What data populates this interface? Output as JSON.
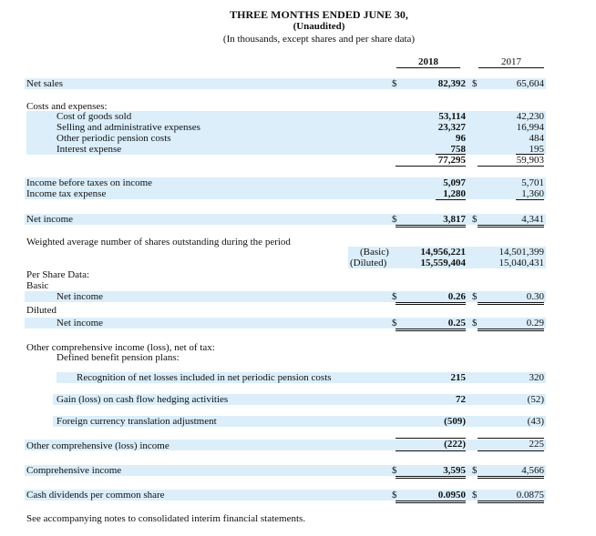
{
  "header": {
    "title": "THREE MONTHS ENDED JUNE 30,",
    "subtitle": "(Unaudited)",
    "note": "(In thousands, except shares and per share data)",
    "year_current": "2018",
    "year_prior": "2017"
  },
  "rows": {
    "net_sales": {
      "label": "Net sales",
      "cur_sym": "$",
      "cur": "82,392",
      "pri_sym": "$",
      "pri": "65,604"
    },
    "costs_header": "Costs and expenses:",
    "cogs": {
      "label": "Cost of goods sold",
      "cur": "53,114",
      "pri": "42,230"
    },
    "sga": {
      "label": "Selling and administrative expenses",
      "cur": "23,327",
      "pri": "16,994"
    },
    "pension": {
      "label": "Other periodic pension costs",
      "cur": "96",
      "pri": "484"
    },
    "interest": {
      "label": "Interest expense",
      "cur": "758",
      "pri": "195"
    },
    "costs_total": {
      "cur": "77,295",
      "pri": "59,903"
    },
    "income_before_tax": {
      "label": "Income before taxes on income",
      "cur": "5,097",
      "pri": "5,701"
    },
    "tax": {
      "label": "Income tax expense",
      "cur": "1,280",
      "pri": "1,360"
    },
    "net_income": {
      "label": "Net income",
      "cur_sym": "$",
      "cur": "3,817",
      "pri_sym": "$",
      "pri": "4,341"
    },
    "weighted_shares": {
      "label": "Weighted average number of shares outstanding during the period"
    },
    "basic_shares": {
      "label": "(Basic)",
      "cur": "14,956,221",
      "pri": "14,501,399"
    },
    "diluted_shares": {
      "label": "(Diluted)",
      "cur": "15,559,404",
      "pri": "15,040,431"
    },
    "per_share_header": "Per Share Data:",
    "basic_header": "Basic",
    "basic_eps": {
      "label": "Net income",
      "cur_sym": "$",
      "cur": "0.26",
      "pri_sym": "$",
      "pri": "0.30"
    },
    "diluted_header": "Diluted",
    "diluted_eps": {
      "label": "Net income",
      "cur_sym": "$",
      "cur": "0.25",
      "pri_sym": "$",
      "pri": "0.29"
    },
    "oci_header": "Other comprehensive income (loss), net of tax:",
    "dbp_header": "Defined benefit pension plans:",
    "recognition": {
      "label": "Recognition of net losses included in net periodic pension costs",
      "cur": "215",
      "pri": "320"
    },
    "hedging": {
      "label": "Gain (loss) on cash flow hedging activities",
      "cur": "72",
      "pri": "(52)"
    },
    "fx": {
      "label": "Foreign currency translation adjustment",
      "cur": "(509)",
      "pri": "(43)"
    },
    "oci_total": {
      "label": "Other comprehensive (loss) income",
      "cur": "(222)",
      "pri": "225"
    },
    "comprehensive": {
      "label": "Comprehensive income",
      "cur_sym": "$",
      "cur": "3,595",
      "pri_sym": "$",
      "pri": "4,566"
    },
    "dividends": {
      "label": "Cash dividends per common share",
      "cur_sym": "$",
      "cur": "0.0950",
      "pri_sym": "$",
      "pri": "0.0875"
    }
  },
  "footer": {
    "note": "See accompanying notes to consolidated interim financial statements."
  }
}
